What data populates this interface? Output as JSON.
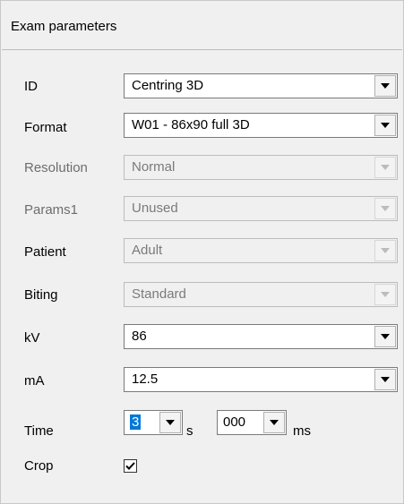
{
  "title": "Exam parameters",
  "fields": {
    "id": {
      "label": "ID",
      "value": "Centring 3D"
    },
    "format": {
      "label": "Format",
      "value": "W01 - 86x90 full 3D"
    },
    "resolution": {
      "label": "Resolution",
      "value": "Normal"
    },
    "params1": {
      "label": "Params1",
      "value": "Unused"
    },
    "patient": {
      "label": "Patient",
      "value": "Adult"
    },
    "biting": {
      "label": "Biting",
      "value": "Standard"
    },
    "kv": {
      "label": "kV",
      "value": "86"
    },
    "ma": {
      "label": "mA",
      "value": "12.5"
    }
  },
  "time": {
    "label": "Time",
    "seconds_value": "3",
    "seconds_unit": "s",
    "ms_value": "000",
    "ms_unit": "ms"
  },
  "crop": {
    "label": "Crop",
    "checked": true
  }
}
